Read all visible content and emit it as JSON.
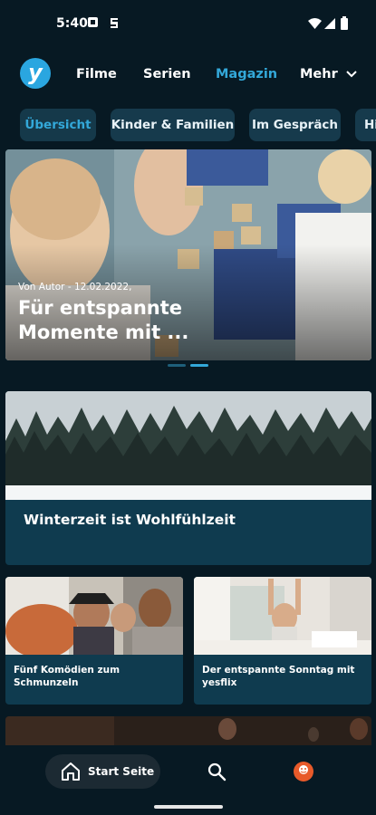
{
  "status": {
    "time": "5:40"
  },
  "nav": {
    "logo_letter": "y",
    "items": [
      {
        "label": "Filme"
      },
      {
        "label": "Serien"
      },
      {
        "label": "Magazin",
        "active": true
      },
      {
        "label": "Mehr"
      }
    ]
  },
  "chips": [
    {
      "label": "Übersicht",
      "active": true
    },
    {
      "label": "Kinder & Familien"
    },
    {
      "label": "Im Gespräch"
    },
    {
      "label": "Hi"
    }
  ],
  "hero": {
    "meta": "Von Autor - 12.02.2022,",
    "title": "Für entspannte Momente mit ...",
    "carousel": {
      "pages": 2,
      "active": 2
    }
  },
  "cards": {
    "featured": {
      "title": "Winterzeit ist Wohlfühlzeit"
    },
    "left": {
      "title": "Fünf Komödien zum Schmunzeln"
    },
    "right": {
      "title": "Der entspannte Sonntag mit yesflix"
    }
  },
  "bottom_nav": {
    "start_label": "Start Seite"
  },
  "colors": {
    "background": "#071923",
    "accent": "#33a8d9",
    "chip_bg": "#163a4c",
    "card_bg": "#0f3b4f",
    "profile": "#e85a2a"
  }
}
